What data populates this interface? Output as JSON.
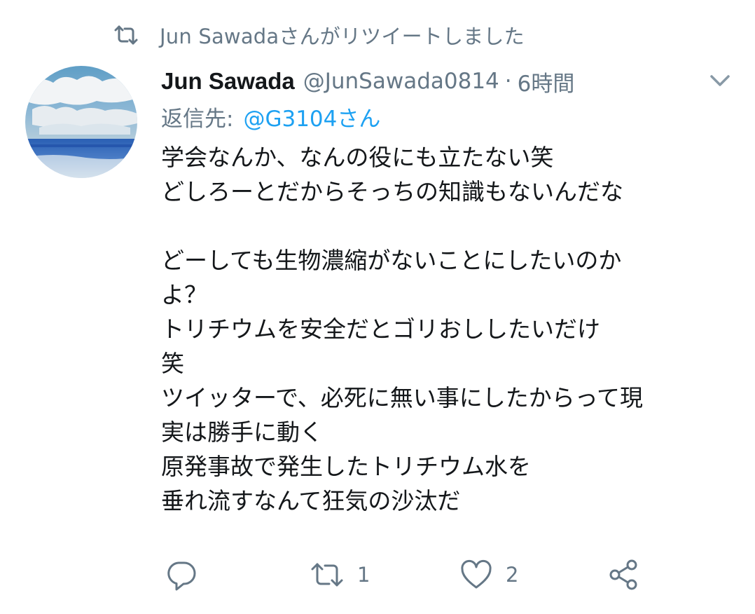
{
  "retweet_banner": {
    "text": "Jun Sawadaさんがリツイートしました",
    "icon": "retweet-icon"
  },
  "tweet": {
    "author": {
      "display_name": "Jun Sawada",
      "handle": "@JunSawada0814",
      "avatar": "sky-and-sea-avatar"
    },
    "separator": "·",
    "timestamp": "6時間",
    "menu_icon": "chevron-down-icon",
    "reply_to": {
      "label": "返信先:",
      "handle": "@G3104さん"
    },
    "lines": [
      "学会なんか、なんの役にも立たない笑",
      "どしろーとだからそっちの知識もないんだな",
      "",
      "どーしても生物濃縮がないことにしたいのか",
      "よ？",
      "トリチウムを安全だとゴリおししたいだけ",
      "笑",
      "ツイッターで、必死に無い事にしたからって現",
      "実は勝手に動く",
      "原発事故で発生したトリチウム水を",
      "垂れ流すなんて狂気の沙汰だ"
    ]
  },
  "actions": {
    "reply": {
      "icon": "reply-icon"
    },
    "retweet": {
      "icon": "retweet-icon",
      "count": "1"
    },
    "like": {
      "icon": "heart-icon",
      "count": "2"
    },
    "share": {
      "icon": "share-icon"
    }
  },
  "colors": {
    "muted": "#657786",
    "link": "#1da1f2",
    "text": "#14171a"
  }
}
